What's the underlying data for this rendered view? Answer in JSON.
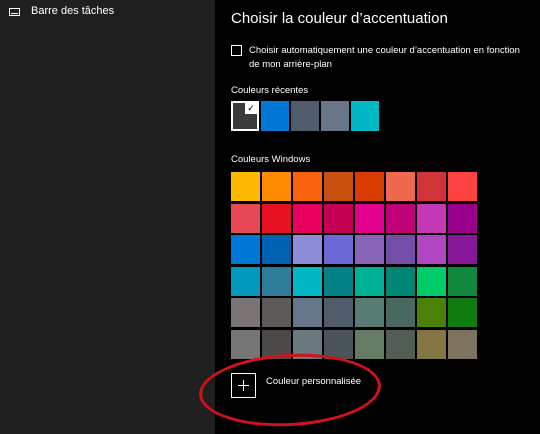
{
  "sidebar": {
    "items": [
      {
        "label": "Barre des tâches",
        "icon": "taskbar-icon"
      }
    ]
  },
  "main": {
    "title": "Choisir la couleur d’accentuation",
    "auto_checkbox": {
      "checked": false,
      "label": "Choisir automatiquement une couleur d’accentuation en fonction de mon arrière-plan"
    },
    "recent": {
      "heading": "Couleurs récentes",
      "colors": [
        "#3a3a3a",
        "#0078d7",
        "#515c6b",
        "#68768a",
        "#00b7c3"
      ],
      "selected_index": 0,
      "check_glyph": "✓"
    },
    "windows_colors": {
      "heading": "Couleurs Windows",
      "rows": [
        [
          "#ffb900",
          "#ff8c00",
          "#f7630c",
          "#ca5010",
          "#da3b01",
          "#ef6950",
          "#d13438",
          "#ff4343"
        ],
        [
          "#e74856",
          "#e81123",
          "#ea005e",
          "#c30052",
          "#e3008c",
          "#bf0077",
          "#c239b3",
          "#9a0089"
        ],
        [
          "#0078d7",
          "#0063b1",
          "#8e8cd8",
          "#6b69d6",
          "#8764b8",
          "#744da9",
          "#b146c2",
          "#881798"
        ],
        [
          "#0099bc",
          "#2d7d9a",
          "#00b7c3",
          "#038387",
          "#00b294",
          "#018574",
          "#00cc6a",
          "#10893e"
        ],
        [
          "#7a7574",
          "#5d5a58",
          "#68768a",
          "#515c6b",
          "#567c73",
          "#486860",
          "#498205",
          "#107c10"
        ],
        [
          "#767676",
          "#4c4a48",
          "#69797e",
          "#4a5459",
          "#647c64",
          "#525e54",
          "#847545",
          "#7e735f"
        ]
      ]
    },
    "custom": {
      "label": "Couleur personnalisée",
      "icon": "plus-icon"
    }
  },
  "annotation": {
    "color": "#d0121b",
    "shape": "ellipse"
  }
}
